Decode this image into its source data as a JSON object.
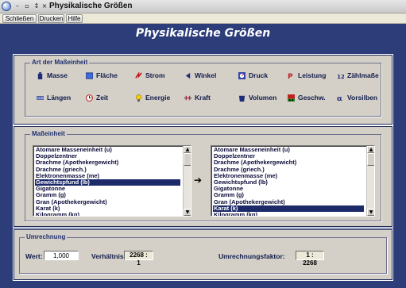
{
  "window": {
    "title": "Physikalische Größen"
  },
  "menu": [
    {
      "label": "Schließen"
    },
    {
      "label": "Drucken"
    },
    {
      "label": "Hilfe"
    }
  ],
  "banner": {
    "title": "Physikalische Größen"
  },
  "unit_types": {
    "label": "Art der Maßeinheit",
    "items": [
      {
        "label": "Masse",
        "icon": "weight-icon",
        "color": "#1f2c7a"
      },
      {
        "label": "Fläche",
        "icon": "area-icon",
        "color": "#3d6ed8"
      },
      {
        "label": "Strom",
        "icon": "current-icon",
        "color": "#c01818"
      },
      {
        "label": "Winkel",
        "icon": "angle-icon",
        "color": "#1f2c7a"
      },
      {
        "label": "Druck",
        "icon": "pressure-icon",
        "color": "#3344aa"
      },
      {
        "label": "Leistung",
        "icon": "power-icon",
        "color": "#c02020"
      },
      {
        "label": "Zählmaße",
        "icon": "count-icon",
        "color": "#1f2c7a"
      },
      {
        "label": "Längen",
        "icon": "length-icon",
        "color": "#1f2c7a"
      },
      {
        "label": "Zeit",
        "icon": "clock-icon",
        "color": "#c02020"
      },
      {
        "label": "Energie",
        "icon": "bulb-icon",
        "color": "#e0b000"
      },
      {
        "label": "Kraft",
        "icon": "force-icon",
        "color": "#c02020"
      },
      {
        "label": "Volumen",
        "icon": "volume-icon",
        "color": "#1f2c7a"
      },
      {
        "label": "Geschw.",
        "icon": "speed-icon",
        "color": "#2a8a2a"
      },
      {
        "label": "Vorsilben",
        "icon": "prefix-icon",
        "color": "#1f2c7a"
      }
    ]
  },
  "units": {
    "label": "Maßeinheit",
    "items": [
      "Atomare Masseneinheit (u)",
      "Doppelzentner",
      "Drachme (Apothekergewicht)",
      "Drachme (griech.)",
      "Elektronenmasse (me)",
      "Gewichtspfund (lb)",
      "Gigatonne",
      "Gramm (g)",
      "Gran (Apothekergewicht)",
      "Karat (k)",
      "Kilogramm (kg)"
    ],
    "left_selected": "Gewichtspfund (lb)",
    "right_selected": "Karat (k)"
  },
  "conversion": {
    "label": "Umrechnung",
    "value_label": "Wert:",
    "value": "1,000",
    "ratio_label": "Verhältnis:",
    "ratio": "2268 : 1",
    "factor_label": "Umrechnungsfaktor:",
    "factor": "1 : 2268"
  },
  "colors": {
    "background": "#2c3d79",
    "selection": "#1c2a6a",
    "panel": "#d4d0c8"
  }
}
